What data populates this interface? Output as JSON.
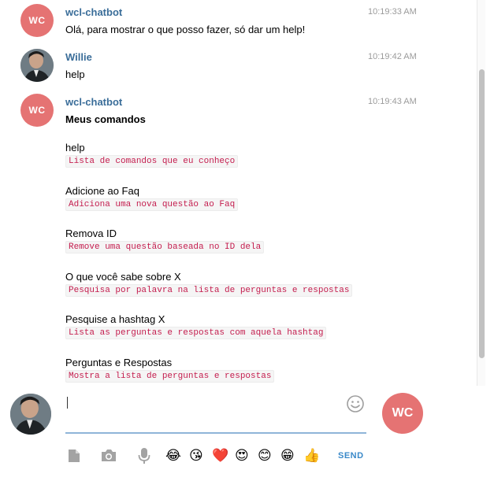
{
  "messages": [
    {
      "user": "wcl-chatbot",
      "time": "10:19:33 AM",
      "avatar_initials": "WC",
      "text": "Olá, para mostrar o que posso fazer, só dar um help!"
    },
    {
      "user": "Willie",
      "time": "10:19:42 AM",
      "text": "help"
    },
    {
      "user": "wcl-chatbot",
      "time": "10:19:43 AM",
      "avatar_initials": "WC",
      "heading": "Meus comandos",
      "commands": [
        {
          "name": "help",
          "description": "Lista de comandos que eu conheço"
        },
        {
          "name": "Adicione ao Faq",
          "description": "Adiciona uma nova questão ao Faq"
        },
        {
          "name": "Remova ID",
          "description": "Remove uma questão baseada no ID dela"
        },
        {
          "name": "O que você sabe sobre X",
          "description": "Pesquisa por palavra na lista de perguntas e respostas"
        },
        {
          "name": "Pesquise a hashtag X",
          "description": "Lista as perguntas e respostas com aquela hashtag"
        },
        {
          "name": "Perguntas e Respostas",
          "description": "Mostra a lista de perguntas e respostas"
        }
      ]
    }
  ],
  "composer": {
    "value": "",
    "avatar_initials": "WC",
    "icons": [
      "file-icon",
      "camera-icon",
      "microphone-icon",
      "smiley-icon"
    ],
    "emojis": [
      "😂",
      "😘",
      "❤️",
      "😍",
      "😊",
      "😁",
      "👍"
    ],
    "send_label": "SEND"
  },
  "colors": {
    "bot_avatar": "#e57373",
    "username": "#3a6d99",
    "code_text": "#c41d4e",
    "send": "#3a89c9",
    "input_underline": "#8fb5d8"
  }
}
